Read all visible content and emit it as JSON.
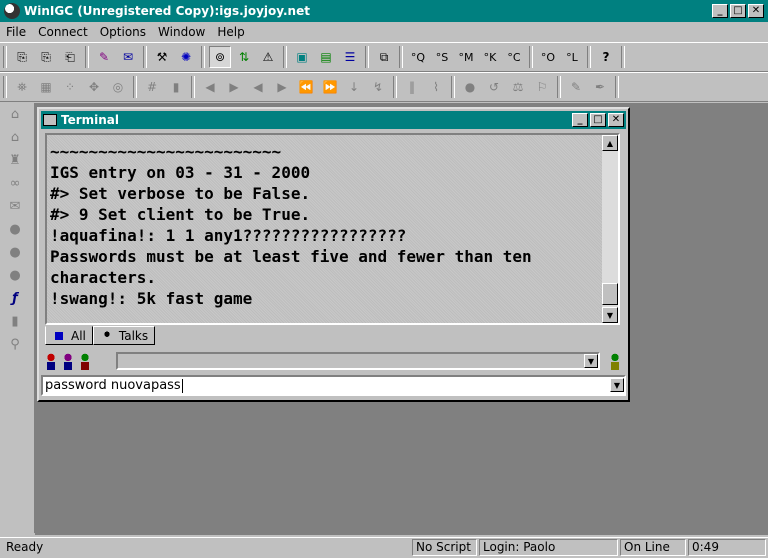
{
  "app": {
    "title": "WinIGC (Unregistered Copy):igs.joyjoy.net"
  },
  "window_controls": {
    "minimize": "_",
    "maximize": "□",
    "close": "✕"
  },
  "menu": [
    "File",
    "Connect",
    "Options",
    "Window",
    "Help"
  ],
  "toolbar1": {
    "stone_buttons": [
      "°Q",
      "°S",
      "°M",
      "°K",
      "°C"
    ],
    "observe_buttons": [
      "°O",
      "°L"
    ],
    "help": "?"
  },
  "terminal": {
    "title": "Terminal",
    "lines": [
      "~~~~~~~~~~~~~~~~~~~~~~~~",
      "IGS entry on 03 - 31 - 2000",
      "#> Set verbose to be False.",
      "#> 9 Set client to be True.",
      "!aquafina!: 1 1 any1?????????????????",
      "Passwords must be at least five and fewer than ten",
      "characters.",
      "!swang!: 5k fast game"
    ],
    "tabs": [
      {
        "label": "All",
        "active": true
      },
      {
        "label": "Talks",
        "active": false
      }
    ],
    "combo_value": "",
    "command_input": "password nuovapass"
  },
  "status": {
    "ready": "Ready",
    "script": "No Script",
    "login": "Login: Paolo",
    "online": "On Line",
    "time": "0:49"
  },
  "colors": {
    "titlebar": "#008080",
    "face": "#c0c0c0",
    "workspace": "#808080"
  }
}
